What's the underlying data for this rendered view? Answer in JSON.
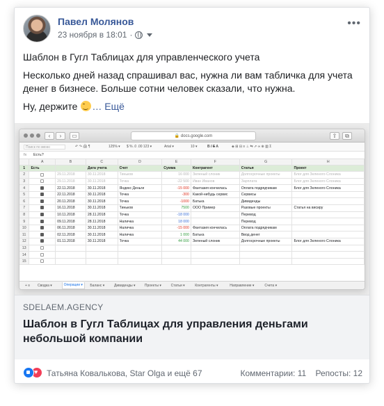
{
  "post": {
    "author": "Павел Молянов",
    "timestamp": "23 ноября в 18:01",
    "visibility_icon": "globe-icon",
    "more_label": "•••",
    "text": [
      "Шаблон в Гугл Таблицах для управленческого учета",
      "Несколько дней назад спрашивал вас, нужна ли вам табличка для учета денег в бизнесе. Больше сотни человек сказали, что нужна.",
      "Ну, держите"
    ],
    "see_more": "… Ещё"
  },
  "screenshot": {
    "url": "docs.google.com",
    "formula_ref": "A1",
    "formula_value": "Есть?",
    "columns": [
      "A",
      "B",
      "C",
      "D",
      "E",
      "F",
      "G",
      "H"
    ],
    "headers": [
      "Есть",
      "",
      "Дата учета",
      "Счет",
      "Сумма",
      "Контрагент",
      "Статья",
      "Проект"
    ],
    "rows": [
      {
        "n": "2",
        "check": false,
        "date": "29.11.2018",
        "date2": "30.11.2018",
        "account": "Тиньков",
        "sum": "16 000",
        "sumc": "dim",
        "party": "Зеленый слоник",
        "item": "Долгосрочные проекты",
        "project": "Блог для Зеленого Слоника",
        "dim": true
      },
      {
        "n": "3",
        "check": false,
        "date": "29.11.2018",
        "date2": "30.11.2018",
        "account": "Точка",
        "sum": "-22 500",
        "sumc": "dim",
        "party": "Иван Иванов",
        "item": "Зарплата",
        "project": "Блог для Зеленого Слоника",
        "dim": true
      },
      {
        "n": "4",
        "check": true,
        "date": "22.11.2018",
        "date2": "30.11.2018",
        "account": "Яндекс Деньги",
        "sum": "-15 000",
        "sumc": "neg",
        "party": "Фантазия кончилась",
        "item": "Оплата подрядчикам",
        "project": "Блог для Зеленого Слоника",
        "dim": false
      },
      {
        "n": "5",
        "check": true,
        "date": "22.11.2018",
        "date2": "30.11.2018",
        "account": "Точка",
        "sum": "-300",
        "sumc": "neg",
        "party": "Какой-нибудь сервис",
        "item": "Сервисы",
        "project": "",
        "dim": false
      },
      {
        "n": "6",
        "check": true,
        "date": "20.11.2018",
        "date2": "30.11.2018",
        "account": "Точка",
        "sum": "-1000",
        "sumc": "neg",
        "party": "Батька",
        "item": "Дивиденды",
        "project": "",
        "dim": false
      },
      {
        "n": "7",
        "check": true,
        "date": "16.11.2018",
        "date2": "30.11.2018",
        "account": "Тиньков",
        "sum": "7500",
        "sumc": "pos",
        "party": "ООО Пример",
        "item": "Разовые проекты",
        "project": "Статья на висиру",
        "dim": false
      },
      {
        "n": "8",
        "check": true,
        "date": "10.11.2018",
        "date2": "28.11.2018",
        "account": "Точка",
        "sum": "-18 000",
        "sumc": "blu",
        "party": "",
        "item": "Перевод",
        "project": "",
        "dim": false
      },
      {
        "n": "9",
        "check": true,
        "date": "09.11.2018",
        "date2": "28.11.2018",
        "account": "Наличка",
        "sum": "18 000",
        "sumc": "blu",
        "party": "",
        "item": "Перевод",
        "project": "",
        "dim": false
      },
      {
        "n": "10",
        "check": true,
        "date": "06.11.2018",
        "date2": "30.11.2018",
        "account": "Наличка",
        "sum": "-15 000",
        "sumc": "neg",
        "party": "Фантазия кончилась",
        "item": "Оплата подрядчикам",
        "project": "",
        "dim": false
      },
      {
        "n": "11",
        "check": true,
        "date": "02.11.2018",
        "date2": "30.11.2018",
        "account": "Наличка",
        "sum": "1 000",
        "sumc": "pos",
        "party": "Батька",
        "item": "Ввод денег",
        "project": "",
        "dim": false
      },
      {
        "n": "12",
        "check": true,
        "date": "01.11.2018",
        "date2": "30.11.2018",
        "account": "Точка",
        "sum": "44 000",
        "sumc": "pos",
        "party": "Зеленый слоник",
        "item": "Долгосрочные проекты",
        "project": "Блог для Зеленого Слоника",
        "dim": false
      },
      {
        "n": "13",
        "check": false,
        "date": "",
        "date2": "",
        "account": "",
        "sum": "",
        "sumc": "",
        "party": "",
        "item": "",
        "project": "",
        "dim": false
      },
      {
        "n": "14",
        "check": false,
        "date": "",
        "date2": "",
        "account": "",
        "sum": "",
        "sumc": "",
        "party": "",
        "item": "",
        "project": "",
        "dim": false
      },
      {
        "n": "15",
        "check": false,
        "date": "",
        "date2": "",
        "account": "",
        "sum": "",
        "sumc": "",
        "party": "",
        "item": "",
        "project": "",
        "dim": false
      }
    ],
    "sheet_tabs": [
      "Сводка",
      "Операции",
      "Баланс",
      "Дивиденды",
      "Проекты",
      "Статьи",
      "Контрагенты",
      "Направление",
      "Счета"
    ],
    "active_tab": "Операции"
  },
  "link": {
    "domain": "SDELAEM.AGENCY",
    "title": "Шаблон в Гугл Таблицах для управления деньгами небольшой компании"
  },
  "footer": {
    "reactions": [
      "like-icon",
      "love-icon"
    ],
    "names": "Татьяна Ковалькова, Star Olga и ещё 67",
    "comments": "Комментарии: 11",
    "reposts": "Репосты: 12"
  }
}
